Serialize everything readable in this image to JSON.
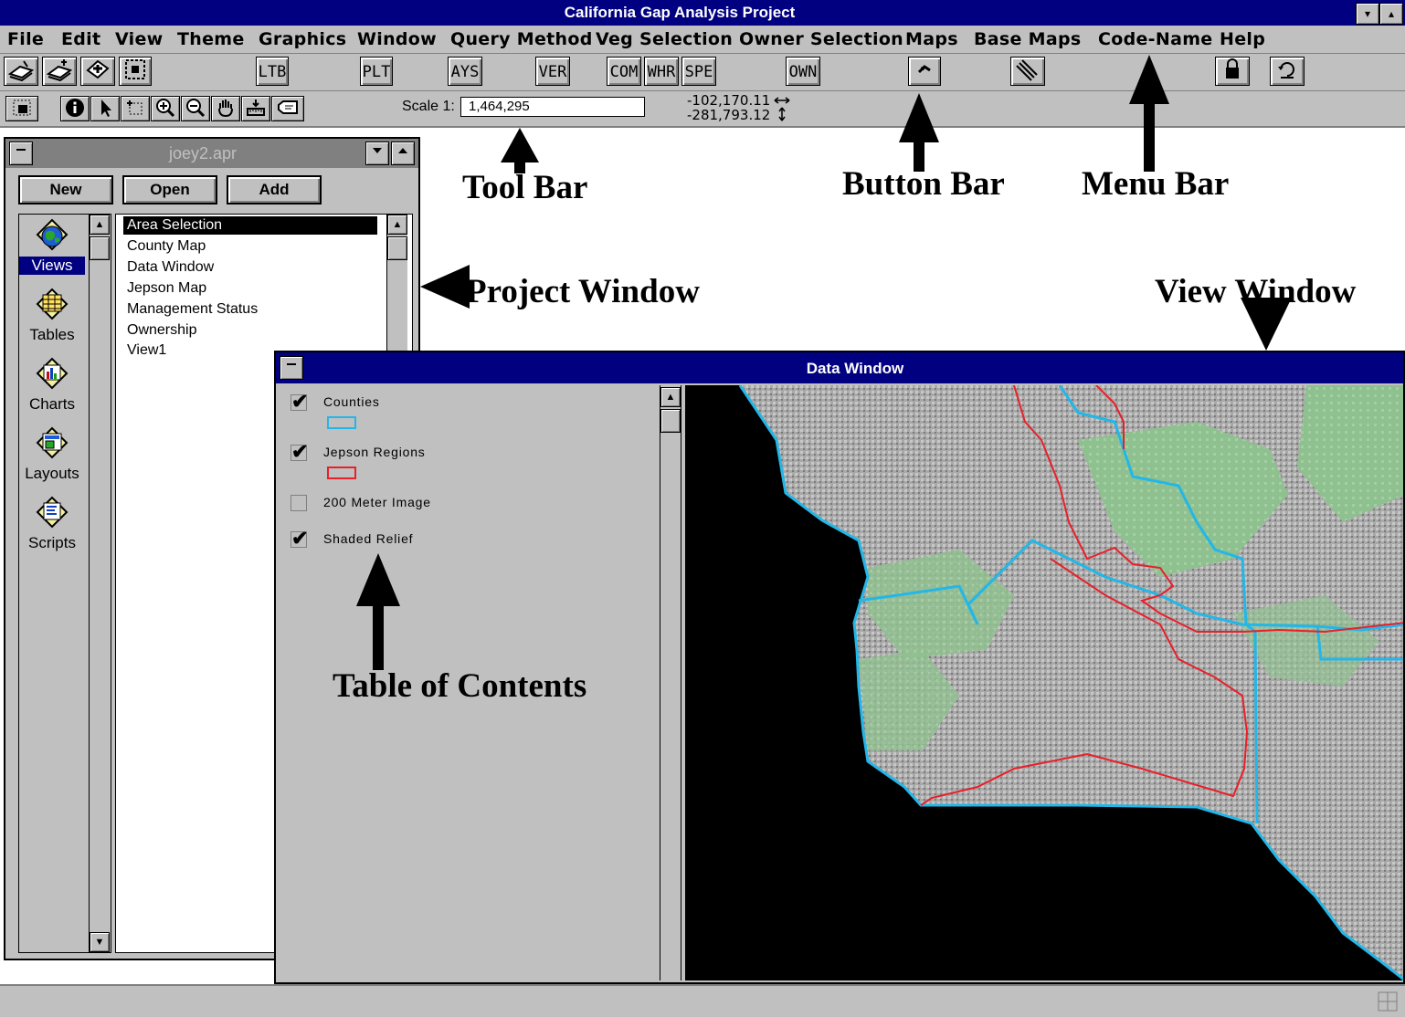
{
  "app": {
    "title": "California Gap Analysis Project",
    "sys_min": "▾",
    "sys_max": "▴"
  },
  "menu": [
    "File",
    "Edit",
    "View",
    "Theme",
    "Graphics",
    "Window",
    "Query Method",
    "Veg Selection",
    "Owner Selection",
    "Maps",
    "Base Maps",
    "Code-Name",
    "Help"
  ],
  "buttons": {
    "ltb": "LTB",
    "plt": "PLT",
    "ays": "AYS",
    "ver": "VER",
    "com": "COM",
    "whr": "WHR",
    "spe": "SPE",
    "own": "OWN"
  },
  "toolbar": {
    "scale_label": "Scale 1:",
    "scale_value": "1,464,295",
    "coord_x": "-102,170.11",
    "coord_y": "-281,793.12"
  },
  "project": {
    "title": "joey2.apr",
    "new_label": "New",
    "open_label": "Open",
    "add_label": "Add",
    "doc_types": [
      "Views",
      "Tables",
      "Charts",
      "Layouts",
      "Scripts"
    ],
    "views": [
      "Area Selection",
      "County Map",
      "Data Window",
      "Jepson Map",
      "Management Status",
      "Ownership",
      "View1"
    ]
  },
  "data_window": {
    "title": "Data Window",
    "themes": [
      {
        "label": "Counties",
        "checked": true,
        "color": "#22b7e8"
      },
      {
        "label": "Jepson Regions",
        "checked": true,
        "color": "#e8202a"
      },
      {
        "label": "200 Meter Image",
        "checked": false
      },
      {
        "label": "Shaded Relief",
        "checked": true
      }
    ]
  },
  "annotations": {
    "tool_bar": "Tool Bar",
    "button_bar": "Button Bar",
    "menu_bar": "Menu Bar",
    "project_window": "Project Window",
    "view_window": "View Window",
    "table_of_contents": "Table of Contents"
  },
  "colors": {
    "titlebar": "#000080",
    "face": "#c0c0c0",
    "land_green": "#8fc08f",
    "relief_gray": "#a9a9a9",
    "county_line": "#22b7e8",
    "jepson_line": "#e8202a"
  }
}
